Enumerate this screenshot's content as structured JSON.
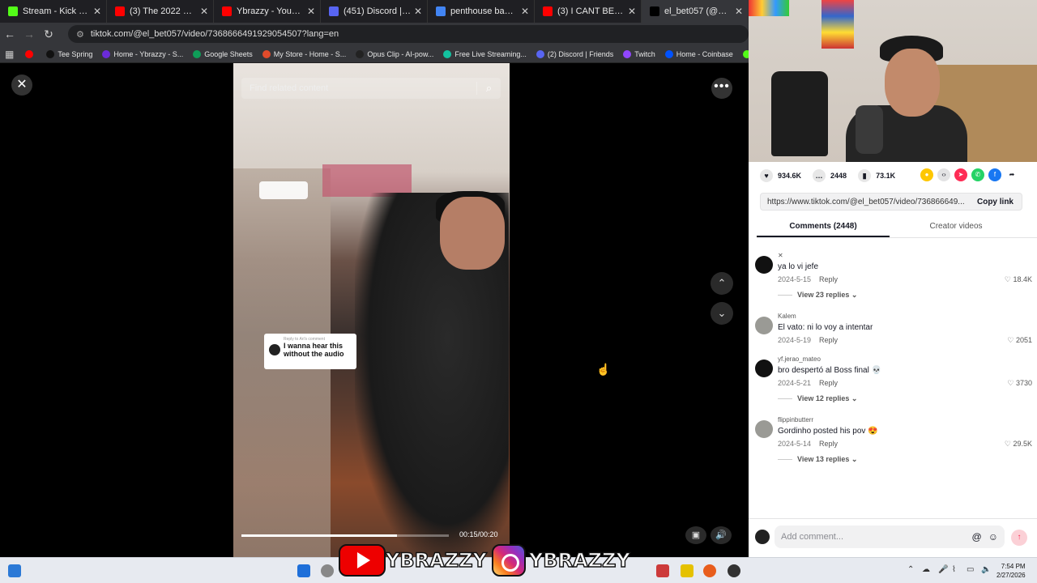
{
  "browser": {
    "tabs": [
      {
        "title": "Stream - Kick Dashboard",
        "color": "#53fc18"
      },
      {
        "title": "(3) The 2022 Mercedes",
        "color": "#ff0000"
      },
      {
        "title": "Ybrazzy - YouTube",
        "color": "#ff0000"
      },
      {
        "title": "(451) Discord | #ybrazzy",
        "color": "#5865f2"
      },
      {
        "title": "penthouse bay area co",
        "color": "#4285f4"
      },
      {
        "title": "(3) I CANT BELIEVE HE S",
        "color": "#ff0000"
      },
      {
        "title": "el_bet057 (@el_bet",
        "color": "#000000"
      }
    ],
    "url": "tiktok.com/@el_bet057/video/7368666491929054507?lang=en",
    "bookmarks": [
      {
        "label": "",
        "color": "#ff0000"
      },
      {
        "label": "Tee Spring",
        "color": "#111111"
      },
      {
        "label": "Home - Ybrazzy - S...",
        "color": "#6b2bd9"
      },
      {
        "label": "Google Sheets",
        "color": "#0f9d58"
      },
      {
        "label": "My Store - Home - S...",
        "color": "#e14b2b"
      },
      {
        "label": "Opus Clip - AI-pow...",
        "color": "#222222"
      },
      {
        "label": "Free Live Streaming...",
        "color": "#13c2a0"
      },
      {
        "label": "(2) Discord | Friends",
        "color": "#5865f2"
      },
      {
        "label": "Twitch",
        "color": "#9146ff"
      },
      {
        "label": "Home - Coinbase",
        "color": "#0052ff"
      },
      {
        "label": "Ybrazzy Stream - W",
        "color": "#53fc18"
      }
    ]
  },
  "player": {
    "search_placeholder": "Find related content",
    "reply_header": "Reply to Ari's comment",
    "reply_text": "I wanna hear this without the audio",
    "progress": 0.75,
    "time": "00:15/00:20"
  },
  "panel": {
    "likes": "934.6K",
    "comments_count": "2448",
    "saves": "73.1K",
    "share_colors": [
      "#fec700",
      "#e3e3e4",
      "#fe2c55",
      "#25d366",
      "#1877f2",
      "#ffffff"
    ],
    "link": "https://www.tiktok.com/@el_bet057/video/736866649...",
    "copy_label": "Copy link",
    "tab_comments": "Comments (2448)",
    "tab_creator": "Creator videos",
    "comments": [
      {
        "name": "✕",
        "text": "ya lo vi jefe",
        "date": "2024-5-15",
        "reply": "Reply",
        "likes": "18.4K",
        "replies": "View 23 replies ⌄",
        "avatar": "dark"
      },
      {
        "name": "Kalem",
        "text": "El vato: ni lo voy a intentar",
        "date": "2024-5-19",
        "reply": "Reply",
        "likes": "2051",
        "replies": "",
        "avatar": "grey"
      },
      {
        "name": "yf.jerao_mateo",
        "text": "bro despertó al Boss final 💀",
        "date": "2024-5-21",
        "reply": "Reply",
        "likes": "3730",
        "replies": "View 12 replies ⌄",
        "avatar": "dark"
      },
      {
        "name": "flippinbutterr",
        "text": "Gordinho posted his pov 😍",
        "date": "2024-5-14",
        "reply": "Reply",
        "likes": "29.5K",
        "replies": "View 13 replies ⌄",
        "avatar": "grey"
      }
    ],
    "add_placeholder": "Add comment..."
  },
  "taskbar": {
    "banner_text_1": "YBRAZZY",
    "banner_text_2": "YBRAZZY",
    "time": "7:54 PM",
    "date": "2/27/2026"
  }
}
